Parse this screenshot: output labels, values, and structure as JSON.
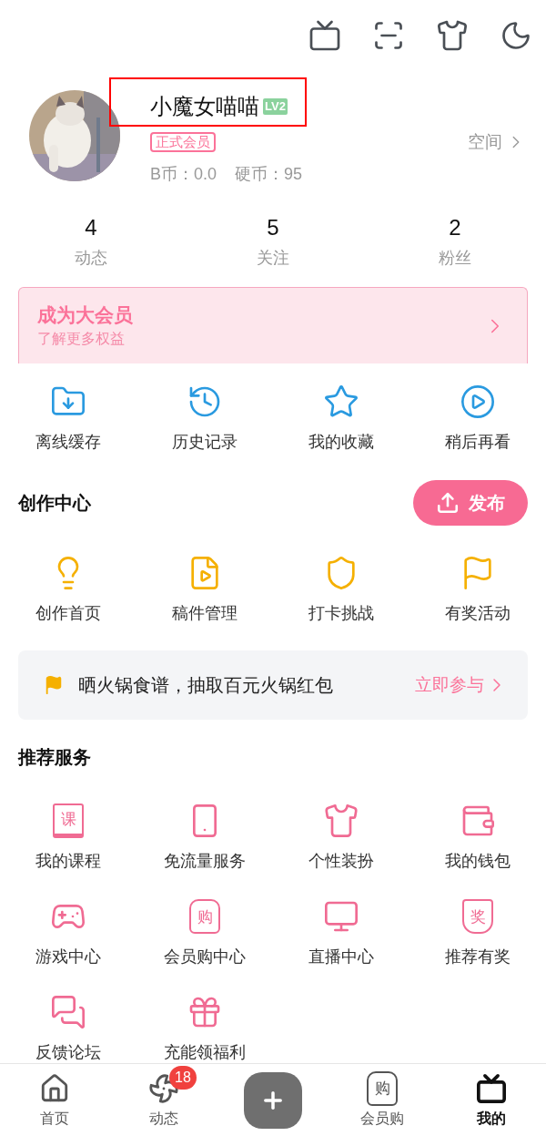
{
  "profile": {
    "name": "小魔女喵喵",
    "name_highlighted": true,
    "level": "LV2",
    "member_tag": "正式会员",
    "b_coins": "B币：0.0",
    "coins": "硬币：95",
    "space_link": "空间"
  },
  "stats": [
    {
      "value": "4",
      "label": "动态"
    },
    {
      "value": "5",
      "label": "关注"
    },
    {
      "value": "2",
      "label": "粉丝"
    }
  ],
  "vip_banner": {
    "title": "成为大会员",
    "subtitle": "了解更多权益"
  },
  "quick_actions": [
    {
      "label": "离线缓存"
    },
    {
      "label": "历史记录"
    },
    {
      "label": "我的收藏"
    },
    {
      "label": "稍后再看"
    }
  ],
  "creation_center": {
    "title": "创作中心",
    "publish_button": "发布",
    "items": [
      {
        "label": "创作首页"
      },
      {
        "label": "稿件管理"
      },
      {
        "label": "打卡挑战"
      },
      {
        "label": "有奖活动"
      }
    ]
  },
  "promo_banner": {
    "text": "晒火锅食谱，抽取百元火锅红包",
    "link": "立即参与"
  },
  "recommended_services": {
    "title": "推荐服务",
    "items": [
      {
        "label": "我的课程",
        "glyph": "课"
      },
      {
        "label": "免流量服务"
      },
      {
        "label": "个性装扮"
      },
      {
        "label": "我的钱包"
      },
      {
        "label": "游戏中心"
      },
      {
        "label": "会员购中心",
        "glyph": "购"
      },
      {
        "label": "直播中心"
      },
      {
        "label": "推荐有奖",
        "glyph": "奖"
      },
      {
        "label": "反馈论坛"
      },
      {
        "label": "充能领福利"
      }
    ]
  },
  "tab_bar": [
    {
      "kind": "tab",
      "label": "首页",
      "selected": false
    },
    {
      "kind": "tab",
      "label": "动态",
      "selected": false,
      "badge": "18"
    },
    {
      "kind": "create"
    },
    {
      "kind": "tab",
      "label": "会员购",
      "selected": false,
      "glyph": "购"
    },
    {
      "kind": "tab",
      "label": "我的",
      "selected": true
    }
  ]
}
